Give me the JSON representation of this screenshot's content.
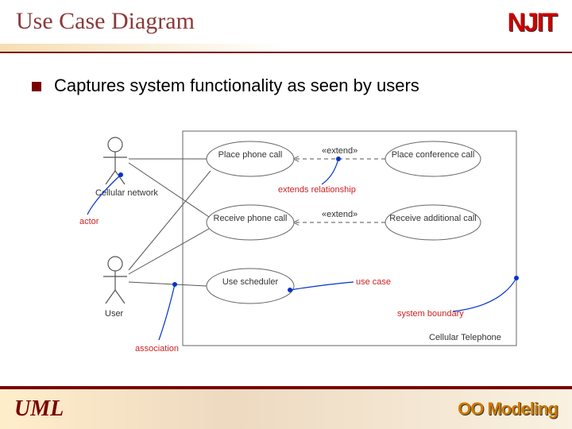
{
  "header": {
    "title": "Use Case Diagram",
    "logo": "NJIT"
  },
  "bullet": {
    "text": "Captures system functionality as seen by users"
  },
  "diagram": {
    "actors": {
      "cellular_network": "Cellular network",
      "user": "User"
    },
    "usecases": {
      "place_call": "Place phone call",
      "receive_call": "Receive phone call",
      "use_scheduler": "Use scheduler",
      "place_conf": "Place conference call",
      "receive_add": "Receive additional call"
    },
    "stereotypes": {
      "extend": "«extend»"
    },
    "captions": {
      "actor": "actor",
      "association": "association",
      "extends_rel": "extends relationship",
      "use_case": "use case",
      "system_boundary": "system boundary"
    },
    "system_label": "Cellular Telephone"
  },
  "footer": {
    "uml": "UML",
    "oom": "OO Modeling"
  }
}
